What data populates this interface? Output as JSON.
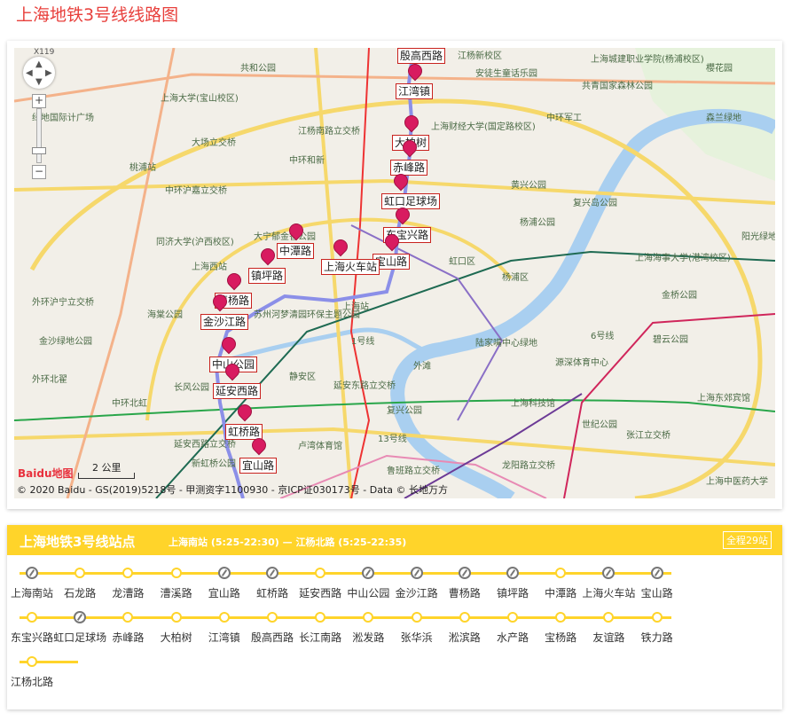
{
  "page": {
    "title": "上海地铁3号线线路图"
  },
  "map": {
    "copyright": "© 2020 Baidu - GS(2019)5218号 - 甲测资字1100930 - 京ICP证030173号 - Data © 长地万方",
    "scale": "2 公里",
    "logo": "Baidu地图",
    "nav_label": "X119",
    "zoom_in": "+",
    "zoom_out": "−",
    "place_labels": [
      "上海大学(宝山校区)",
      "共和公园",
      "上海城建职业学院(杨浦校区)",
      "共青国家森林公园",
      "櫻花园",
      "安徒生童话乐园",
      "上海财经大学(国定路校区)",
      "江杨南路立交桥",
      "大场立交桥",
      "中环和新",
      "中环军工",
      "黄兴公园",
      "复兴岛公园",
      "杨浦公园",
      "大宁郁金香公园",
      "虹口区",
      "杨浦区",
      "上海海事大学(港湾校区)",
      "金桥公园",
      "同济大学(沪西校区)",
      "上海西站",
      "海棠公园",
      "金沙绿地公园",
      "外环沪宁立交桥",
      "中环沪嘉立交桥",
      "外环北翟",
      "中环北虹",
      "长风公园",
      "静安区",
      "外滩",
      "陆家嘴中心绿地",
      "源深体育中心",
      "碧云公园",
      "上海科技馆",
      "世纪公园",
      "张江立交桥",
      "上海东郊宾馆",
      "延安东路立交桥",
      "复兴公园",
      "卢湾体育馆",
      "鲁班路立交桥",
      "龙阳路立交桥",
      "上海中医药大学",
      "延安西路立交桥",
      "新虹桥公园",
      "上海站",
      "1号线",
      "13号线",
      "6号线",
      "阳光绿地",
      "森兰绿地",
      "江杨新校区",
      "桃浦站",
      "绿地国际计广场",
      "苏州河梦清园环保主题公园"
    ],
    "station_labels": [
      "江湾镇",
      "大柏树",
      "赤峰路",
      "虹口足球场",
      "东宝兴路",
      "宝山路",
      "上海火车站",
      "中潭路",
      "镇坪路",
      "曹杨路",
      "金沙江路",
      "中山公园",
      "延安西路",
      "虹桥路",
      "宜山路",
      "殷高西路"
    ]
  },
  "line": {
    "name": "上海地铁3号线站点",
    "times": "上海南站 (5:25-22:30)  —  江杨北路 (5:25-22:35)",
    "total": "全程29站",
    "color": "#ffd42a",
    "rows": [
      [
        {
          "name": "上海南站",
          "transfer": true
        },
        {
          "name": "石龙路",
          "transfer": false
        },
        {
          "name": "龙漕路",
          "transfer": false
        },
        {
          "name": "漕溪路",
          "transfer": false
        },
        {
          "name": "宜山路",
          "transfer": true
        },
        {
          "name": "虹桥路",
          "transfer": true
        },
        {
          "name": "延安西路",
          "transfer": false
        },
        {
          "name": "中山公园",
          "transfer": true
        },
        {
          "name": "金沙江路",
          "transfer": true
        },
        {
          "name": "曹杨路",
          "transfer": true
        },
        {
          "name": "镇坪路",
          "transfer": true
        },
        {
          "name": "中潭路",
          "transfer": false
        },
        {
          "name": "上海火车站",
          "transfer": true
        },
        {
          "name": "宝山路",
          "transfer": true
        }
      ],
      [
        {
          "name": "东宝兴路",
          "transfer": false
        },
        {
          "name": "虹口足球场",
          "transfer": true
        },
        {
          "name": "赤峰路",
          "transfer": false
        },
        {
          "name": "大柏树",
          "transfer": false
        },
        {
          "name": "江湾镇",
          "transfer": false
        },
        {
          "name": "殷高西路",
          "transfer": false
        },
        {
          "name": "长江南路",
          "transfer": false
        },
        {
          "name": "淞发路",
          "transfer": false
        },
        {
          "name": "张华浜",
          "transfer": false
        },
        {
          "name": "淞滨路",
          "transfer": false
        },
        {
          "name": "水产路",
          "transfer": false
        },
        {
          "name": "宝杨路",
          "transfer": false
        },
        {
          "name": "友谊路",
          "transfer": false
        },
        {
          "name": "铁力路",
          "transfer": false
        }
      ],
      [
        {
          "name": "江杨北路",
          "transfer": false
        }
      ]
    ]
  }
}
